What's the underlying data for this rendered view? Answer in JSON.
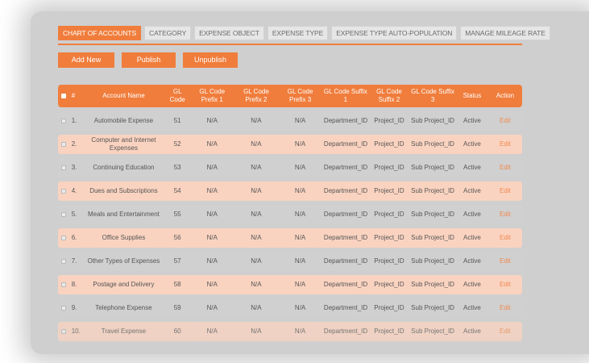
{
  "tabs": [
    {
      "label": "CHART OF ACCOUNTS",
      "active": true
    },
    {
      "label": "CATEGORY",
      "active": false
    },
    {
      "label": "EXPENSE OBJECT",
      "active": false
    },
    {
      "label": "EXPENSE TYPE",
      "active": false
    },
    {
      "label": "EXPENSE TYPE AUTO-POPULATION",
      "active": false
    },
    {
      "label": "MANAGE MILEAGE RATE",
      "active": false
    }
  ],
  "toolbar": {
    "add_new_label": "Add New",
    "publish_label": "Publish",
    "unpublish_label": "Unpublish"
  },
  "table": {
    "headers": {
      "num": "#",
      "account_name": "Account Name",
      "gl_code": "GL Code",
      "prefix1": "GL Code Prefix 1",
      "prefix2": "GL Code Prefix 2",
      "prefix3": "GL Code Prefix 3",
      "suffix1": "GL Code Suffix 1",
      "suffix2": "GL Code Suffix 2",
      "suffix3": "GL Code Suffix 3",
      "status": "Status",
      "action": "Action"
    },
    "rows": [
      {
        "num": "1.",
        "account_name": "Automobile Expense",
        "gl_code": "51",
        "prefix1": "N/A",
        "prefix2": "N/A",
        "prefix3": "N/A",
        "suffix1": "Department_ID",
        "suffix2": "Project_ID",
        "suffix3": "Sub Project_ID",
        "status": "Active",
        "action": "Edit"
      },
      {
        "num": "2.",
        "account_name": "Computer and Internet Expenses",
        "gl_code": "52",
        "prefix1": "N/A",
        "prefix2": "N/A",
        "prefix3": "N/A",
        "suffix1": "Department_ID",
        "suffix2": "Project_ID",
        "suffix3": "Sub Project_ID",
        "status": "Active",
        "action": "Edit"
      },
      {
        "num": "3.",
        "account_name": "Continuing Education",
        "gl_code": "53",
        "prefix1": "N/A",
        "prefix2": "N/A",
        "prefix3": "N/A",
        "suffix1": "Department_ID",
        "suffix2": "Project_ID",
        "suffix3": "Sub Project_ID",
        "status": "Active",
        "action": "Edit"
      },
      {
        "num": "4.",
        "account_name": "Dues and Subscriptions",
        "gl_code": "54",
        "prefix1": "N/A",
        "prefix2": "N/A",
        "prefix3": "N/A",
        "suffix1": "Department_ID",
        "suffix2": "Project_ID",
        "suffix3": "Sub Project_ID",
        "status": "Active",
        "action": "Edit"
      },
      {
        "num": "5.",
        "account_name": "Meals and Entertainment",
        "gl_code": "55",
        "prefix1": "N/A",
        "prefix2": "N/A",
        "prefix3": "N/A",
        "suffix1": "Department_ID",
        "suffix2": "Project_ID",
        "suffix3": "Sub Project_ID",
        "status": "Active",
        "action": "Edit"
      },
      {
        "num": "6.",
        "account_name": "Office Supplies",
        "gl_code": "56",
        "prefix1": "N/A",
        "prefix2": "N/A",
        "prefix3": "N/A",
        "suffix1": "Department_ID",
        "suffix2": "Project_ID",
        "suffix3": "Sub Project_ID",
        "status": "Active",
        "action": "Edit"
      },
      {
        "num": "7.",
        "account_name": "Other Types of Expenses",
        "gl_code": "57",
        "prefix1": "N/A",
        "prefix2": "N/A",
        "prefix3": "N/A",
        "suffix1": "Department_ID",
        "suffix2": "Project_ID",
        "suffix3": "Sub Project_ID",
        "status": "Active",
        "action": "Edit"
      },
      {
        "num": "8.",
        "account_name": "Postage and Delivery",
        "gl_code": "58",
        "prefix1": "N/A",
        "prefix2": "N/A",
        "prefix3": "N/A",
        "suffix1": "Department_ID",
        "suffix2": "Project_ID",
        "suffix3": "Sub Project_ID",
        "status": "Active",
        "action": "Edit"
      },
      {
        "num": "9.",
        "account_name": "Telephone Expense",
        "gl_code": "59",
        "prefix1": "N/A",
        "prefix2": "N/A",
        "prefix3": "N/A",
        "suffix1": "Department_ID",
        "suffix2": "Project_ID",
        "suffix3": "Sub Project_ID",
        "status": "Active",
        "action": "Edit"
      },
      {
        "num": "10.",
        "account_name": "Travel Expense",
        "gl_code": "60",
        "prefix1": "N/A",
        "prefix2": "N/A",
        "prefix3": "N/A",
        "suffix1": "Department_ID",
        "suffix2": "Project_ID",
        "suffix3": "Sub Project_ID",
        "status": "Active",
        "action": "Edit"
      }
    ]
  },
  "colors": {
    "accent": "#f07d3c",
    "row_alt": "#fad3c0",
    "row_base": "#d0d0d0"
  }
}
